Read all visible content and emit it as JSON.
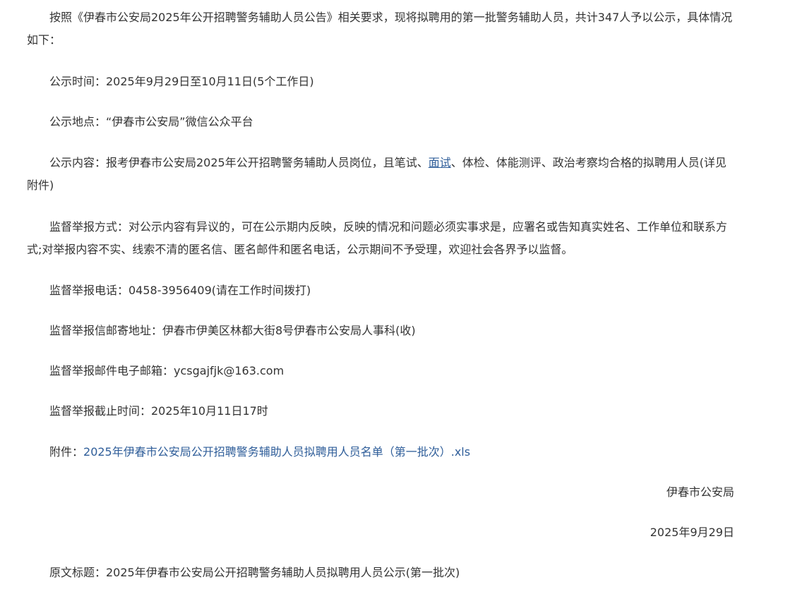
{
  "notice": {
    "intro": "按照《伊春市公安局2025年公开招聘警务辅助人员公告》相关要求，现将拟聘用的第一批警务辅助人员，共计347人予以公示，具体情况如下：",
    "time": "公示时间：2025年9月29日至10月11日(5个工作日)",
    "place": "公示地点：“伊春市公安局”微信公众平台",
    "content_prefix": "公示内容：报考伊春市公安局2025年公开招聘警务辅助人员岗位，且笔试、",
    "content_link": "面试",
    "content_suffix": "、体检、体能测评、政治考察均合格的拟聘用人员(详见附件)",
    "method": "监督举报方式：对公示内容有异议的，可在公示期内反映，反映的情况和问题必须实事求是，应署名或告知真实姓名、工作单位和联系方式;对举报内容不实、线索不清的匿名信、匿名邮件和匿名电话，公示期间不予受理，欢迎社会各界予以监督。",
    "phone": "监督举报电话：0458-3956409(请在工作时间拨打)",
    "address": "监督举报信邮寄地址：伊春市伊美区林都大街8号伊春市公安局人事科(收)",
    "email": "监督举报邮件电子邮箱：ycsgajfjk@163.com",
    "deadline": "监督举报截止时间：2025年10月11日17时",
    "attachment_label": "附件：",
    "attachment_link": "2025年伊春市公安局公开招聘警务辅助人员拟聘用人员名单（第一批次）.xls",
    "organization": "伊春市公安局",
    "date": "2025年9月29日",
    "original_title": "原文标题：2025年伊春市公安局公开招聘警务辅助人员拟聘用人员公示(第一批次)"
  },
  "colors": {
    "text": "#333333",
    "link": "#2e5d99",
    "background": "#ffffff"
  }
}
